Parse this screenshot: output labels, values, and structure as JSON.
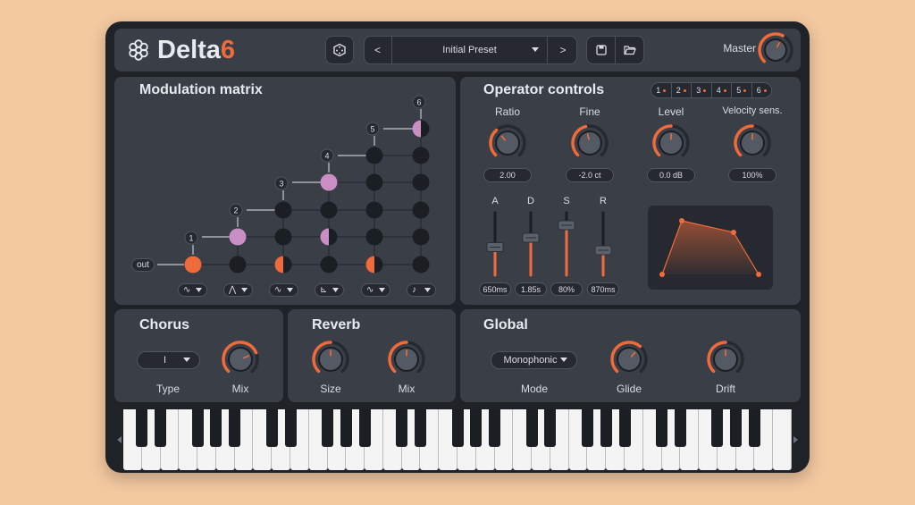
{
  "app": {
    "title_main": "Delta",
    "title_accent": "6"
  },
  "header": {
    "preset_name": "Initial Preset",
    "prev_label": "<",
    "next_label": ">",
    "dice_icon": "dice-icon",
    "save_icon": "save-icon",
    "open_icon": "folder-open-icon",
    "master_label": "Master",
    "master_value": 0.6
  },
  "modulation": {
    "title": "Modulation matrix",
    "out_label": "out",
    "operators": [
      "1",
      "2",
      "3",
      "4",
      "5",
      "6"
    ],
    "waveforms": [
      "∿",
      "⋀",
      "∿",
      "⊾",
      "∿",
      "♪"
    ]
  },
  "operator_controls": {
    "title": "Operator controls",
    "tabs": [
      "1",
      "2",
      "3",
      "4",
      "5",
      "6"
    ],
    "knobs": [
      {
        "label": "Ratio",
        "value": "2.00",
        "level": 0.35
      },
      {
        "label": "Fine",
        "value": "-2.0 ct",
        "level": 0.45
      },
      {
        "label": "Level",
        "value": "0.0 dB",
        "level": 0.5
      },
      {
        "label": "Velocity sens.",
        "value": "100%",
        "level": 0.5
      }
    ],
    "adsr": [
      {
        "label": "A",
        "value": "650ms",
        "level": 0.45
      },
      {
        "label": "D",
        "value": "1.85s",
        "level": 0.6
      },
      {
        "label": "S",
        "value": "80%",
        "level": 0.8
      },
      {
        "label": "R",
        "value": "870ms",
        "level": 0.4
      }
    ]
  },
  "chorus": {
    "title": "Chorus",
    "type_value": "I",
    "type_label": "Type",
    "mix_label": "Mix",
    "mix_level": 0.75
  },
  "reverb": {
    "title": "Reverb",
    "size_label": "Size",
    "mix_label": "Mix",
    "size_level": 0.5,
    "mix_level": 0.5
  },
  "global": {
    "title": "Global",
    "mode_value": "Monophonic",
    "mode_label": "Mode",
    "glide_label": "Glide",
    "drift_label": "Drift",
    "glide_level": 0.65,
    "drift_level": 0.5
  },
  "colors": {
    "accent": "#ef6b3b",
    "panel": "#3a3f47",
    "window": "#1f2227",
    "node": "#1b1e22",
    "pink": "#c98fc4"
  }
}
